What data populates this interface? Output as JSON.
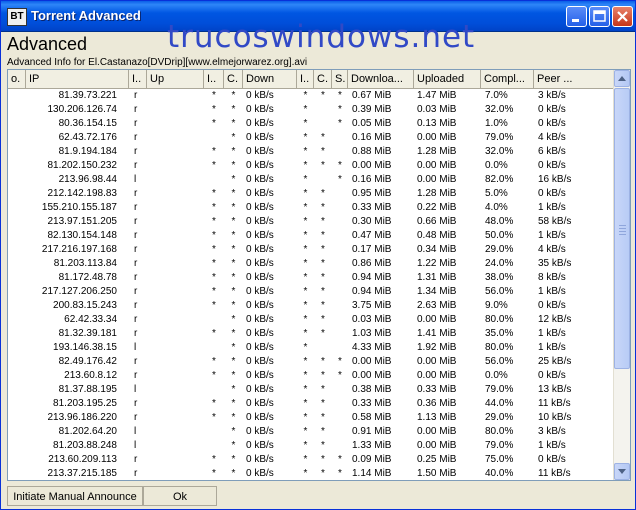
{
  "window": {
    "title": "Torrent Advanced",
    "app_icon_text": "BT",
    "heading": "Advanced",
    "watermark": "trucoswindows.net",
    "info": "Advanced Info for El.Castanazo[DVDrip][www.elmejorwarez.org].avi"
  },
  "columns": [
    "o.",
    "IP",
    "I..",
    "Up",
    "I..",
    "C.",
    "Down",
    "I..",
    "C.",
    "S.",
    "Downloa...",
    "Uploaded",
    "Compl...",
    "Peer ..."
  ],
  "rows": [
    [
      "",
      "81.39.73.221",
      "r",
      "",
      "*",
      "*",
      "0 kB/s",
      "*",
      "*",
      "*",
      "0.67 MiB",
      "1.47 MiB",
      "7.0%",
      "3 kB/s"
    ],
    [
      "",
      "130.206.126.74",
      "r",
      "",
      "*",
      "*",
      "0 kB/s",
      "*",
      "",
      "*",
      "0.39 MiB",
      "0.03 MiB",
      "32.0%",
      "0 kB/s"
    ],
    [
      "",
      "80.36.154.15",
      "r",
      "",
      "*",
      "*",
      "0 kB/s",
      "*",
      "",
      "*",
      "0.05 MiB",
      "0.13 MiB",
      "1.0%",
      "0 kB/s"
    ],
    [
      "",
      "62.43.72.176",
      "r",
      "",
      "",
      "*",
      "0 kB/s",
      "*",
      "*",
      "",
      "0.16 MiB",
      "0.00 MiB",
      "79.0%",
      "4 kB/s"
    ],
    [
      "",
      "81.9.194.184",
      "r",
      "",
      "*",
      "*",
      "0 kB/s",
      "*",
      "*",
      "",
      "0.88 MiB",
      "1.28 MiB",
      "32.0%",
      "6 kB/s"
    ],
    [
      "",
      "81.202.150.232",
      "r",
      "",
      "*",
      "*",
      "0 kB/s",
      "*",
      "*",
      "*",
      "0.00 MiB",
      "0.00 MiB",
      "0.0%",
      "0 kB/s"
    ],
    [
      "",
      "213.96.98.44",
      "l",
      "",
      "",
      "*",
      "0 kB/s",
      "*",
      "",
      "*",
      "0.16 MiB",
      "0.00 MiB",
      "82.0%",
      "16 kB/s"
    ],
    [
      "",
      "212.142.198.83",
      "r",
      "",
      "*",
      "*",
      "0 kB/s",
      "*",
      "*",
      "",
      "0.95 MiB",
      "1.28 MiB",
      "5.0%",
      "0 kB/s"
    ],
    [
      "",
      "155.210.155.187",
      "r",
      "",
      "*",
      "*",
      "0 kB/s",
      "*",
      "*",
      "",
      "0.33 MiB",
      "0.22 MiB",
      "4.0%",
      "1 kB/s"
    ],
    [
      "",
      "213.97.151.205",
      "r",
      "",
      "*",
      "*",
      "0 kB/s",
      "*",
      "*",
      "",
      "0.30 MiB",
      "0.66 MiB",
      "48.0%",
      "58 kB/s"
    ],
    [
      "",
      "82.130.154.148",
      "r",
      "",
      "*",
      "*",
      "0 kB/s",
      "*",
      "*",
      "",
      "0.47 MiB",
      "0.48 MiB",
      "50.0%",
      "1 kB/s"
    ],
    [
      "",
      "217.216.197.168",
      "r",
      "",
      "*",
      "*",
      "0 kB/s",
      "*",
      "*",
      "",
      "0.17 MiB",
      "0.34 MiB",
      "29.0%",
      "4 kB/s"
    ],
    [
      "",
      "81.203.113.84",
      "r",
      "",
      "*",
      "*",
      "0 kB/s",
      "*",
      "*",
      "",
      "0.86 MiB",
      "1.22 MiB",
      "24.0%",
      "35 kB/s"
    ],
    [
      "",
      "81.172.48.78",
      "r",
      "",
      "*",
      "*",
      "0 kB/s",
      "*",
      "*",
      "",
      "0.94 MiB",
      "1.31 MiB",
      "38.0%",
      "8 kB/s"
    ],
    [
      "",
      "217.127.206.250",
      "r",
      "",
      "*",
      "*",
      "0 kB/s",
      "*",
      "*",
      "",
      "0.94 MiB",
      "1.34 MiB",
      "56.0%",
      "1 kB/s"
    ],
    [
      "",
      "200.83.15.243",
      "r",
      "",
      "*",
      "*",
      "0 kB/s",
      "*",
      "*",
      "",
      "3.75 MiB",
      "2.63 MiB",
      "9.0%",
      "0 kB/s"
    ],
    [
      "",
      "62.42.33.34",
      "r",
      "",
      "",
      "*",
      "0 kB/s",
      "*",
      "*",
      "",
      "0.03 MiB",
      "0.00 MiB",
      "80.0%",
      "12 kB/s"
    ],
    [
      "",
      "81.32.39.181",
      "r",
      "",
      "*",
      "*",
      "0 kB/s",
      "*",
      "*",
      "",
      "1.03 MiB",
      "1.41 MiB",
      "35.0%",
      "1 kB/s"
    ],
    [
      "",
      "193.146.38.15",
      "l",
      "",
      "",
      "*",
      "0 kB/s",
      "*",
      "",
      "",
      "4.33 MiB",
      "1.92 MiB",
      "80.0%",
      "1 kB/s"
    ],
    [
      "",
      "82.49.176.42",
      "r",
      "",
      "*",
      "*",
      "0 kB/s",
      "*",
      "*",
      "*",
      "0.00 MiB",
      "0.00 MiB",
      "56.0%",
      "25 kB/s"
    ],
    [
      "",
      "213.60.8.12",
      "r",
      "",
      "*",
      "*",
      "0 kB/s",
      "*",
      "*",
      "*",
      "0.00 MiB",
      "0.00 MiB",
      "0.0%",
      "0 kB/s"
    ],
    [
      "",
      "81.37.88.195",
      "l",
      "",
      "",
      "*",
      "0 kB/s",
      "*",
      "*",
      "",
      "0.38 MiB",
      "0.33 MiB",
      "79.0%",
      "13 kB/s"
    ],
    [
      "",
      "81.203.195.25",
      "r",
      "",
      "*",
      "*",
      "0 kB/s",
      "*",
      "*",
      "",
      "0.33 MiB",
      "0.36 MiB",
      "44.0%",
      "11 kB/s"
    ],
    [
      "",
      "213.96.186.220",
      "r",
      "",
      "*",
      "*",
      "0 kB/s",
      "*",
      "*",
      "",
      "0.58 MiB",
      "1.13 MiB",
      "29.0%",
      "10 kB/s"
    ],
    [
      "",
      "81.202.64.20",
      "l",
      "",
      "",
      "*",
      "0 kB/s",
      "*",
      "*",
      "",
      "0.91 MiB",
      "0.00 MiB",
      "80.0%",
      "3 kB/s"
    ],
    [
      "",
      "81.203.88.248",
      "l",
      "",
      "",
      "*",
      "0 kB/s",
      "*",
      "*",
      "",
      "1.33 MiB",
      "0.00 MiB",
      "79.0%",
      "1 kB/s"
    ],
    [
      "",
      "213.60.209.113",
      "r",
      "",
      "*",
      "*",
      "0 kB/s",
      "*",
      "*",
      "*",
      "0.09 MiB",
      "0.25 MiB",
      "75.0%",
      "0 kB/s"
    ],
    [
      "",
      "213.37.215.185",
      "r",
      "",
      "*",
      "*",
      "0 kB/s",
      "*",
      "*",
      "*",
      "1.14 MiB",
      "1.50 MiB",
      "40.0%",
      "11 kB/s"
    ]
  ],
  "statusbar": {
    "announce_label": "Initiate Manual Announce",
    "ok_label": "Ok"
  }
}
